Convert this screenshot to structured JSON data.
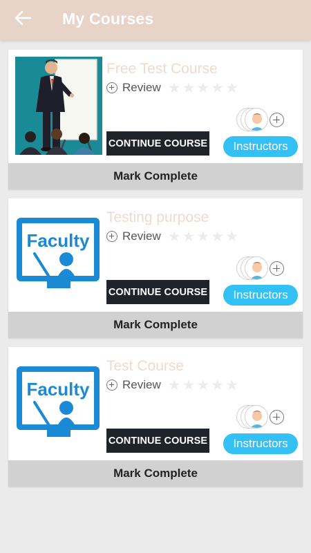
{
  "header": {
    "title": "My Courses",
    "back_icon": "arrow-left-icon",
    "background_color": "#e8d3c8"
  },
  "courses": [
    {
      "title": "Free Test Course",
      "image": "presenter-whiteboard-image",
      "review_label": "Review",
      "rating": 0,
      "max_rating": 5,
      "continue_label": "CONTINUE COURSE",
      "instructors_label": "Instructors",
      "mark_complete_label": "Mark Complete"
    },
    {
      "title": "Testing purpose",
      "image": "faculty-logo-image",
      "image_text": "Faculty",
      "review_label": "Review",
      "rating": 0,
      "max_rating": 5,
      "continue_label": "CONTINUE COURSE",
      "instructors_label": "Instructors",
      "mark_complete_label": "Mark Complete"
    },
    {
      "title": "Test Course",
      "image": "faculty-logo-image",
      "image_text": "Faculty",
      "review_label": "Review",
      "rating": 0,
      "max_rating": 5,
      "continue_label": "CONTINUE COURSE",
      "instructors_label": "Instructors",
      "mark_complete_label": "Mark Complete"
    }
  ],
  "colors": {
    "accent_blue": "#33c1f5",
    "continue_dark": "#1f242b",
    "title_peach": "#f1d9cf",
    "faculty_blue": "#1a8ad4"
  }
}
